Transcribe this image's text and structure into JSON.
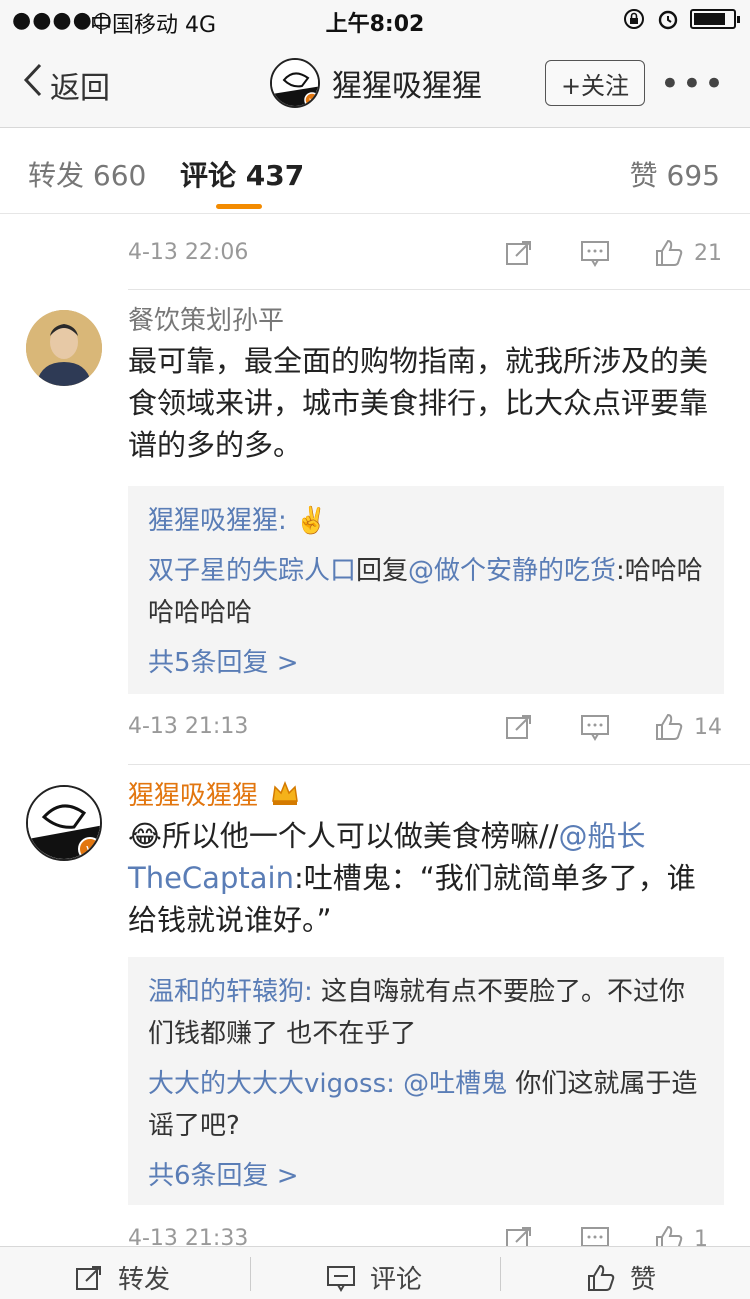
{
  "status_bar": {
    "signal": "●●●●○",
    "carrier": "中国移动  4G",
    "time": "上午8:02"
  },
  "nav": {
    "back_label": "返回",
    "title": "猩猩吸猩猩",
    "follow_label": "+关注",
    "more_label": "•••"
  },
  "tabs": [
    {
      "label": "转发 660"
    },
    {
      "label": "评论 437"
    },
    {
      "label": "赞 695"
    }
  ],
  "items": [
    {
      "time": "4-13 22:06",
      "likes": "21"
    },
    {
      "name": "餐饮策划孙平",
      "body": "最可靠，最全面的购物指南，就我所涉及的美食领域来讲，城市美食排行，比大众点评要靠谱的多的多。",
      "replies": [
        {
          "user": "猩猩吸猩猩:",
          "text": " ✌️"
        },
        {
          "user": "双子星的失踪人口",
          "text": "回复",
          "mention": "@做个安静的吃货",
          "text2": ":哈哈哈哈哈哈哈"
        }
      ],
      "total": "共5条回复 >",
      "time": "4-13 21:13",
      "likes": "14"
    },
    {
      "name": "猩猩吸猩猩",
      "body_emoji": "😂",
      "body_a": "所以他一个人可以做美食榜嘛//",
      "body_mention": "@船长TheCaptain",
      "body_b": ":吐槽鬼：“我们就简单多了，谁给钱就说谁好。”",
      "replies": [
        {
          "user": "温和的轩辕狗:",
          "text": " 这自嗨就有点不要脸了。不过你们钱都赚了 也不在乎了"
        },
        {
          "user": "大大的大大大vigoss:",
          "mention": " @吐槽鬼",
          "text": " 你们这就属于造谣了吧?"
        }
      ],
      "total": "共6条回复 >",
      "time": "4-13 21:33",
      "likes": "1"
    }
  ],
  "bottom_bar": {
    "repost": "转发",
    "comment": "评论",
    "like": "赞"
  },
  "colors": {
    "accent": "#f38b00",
    "link": "#5a7db6",
    "vip_name": "#e2760f"
  }
}
